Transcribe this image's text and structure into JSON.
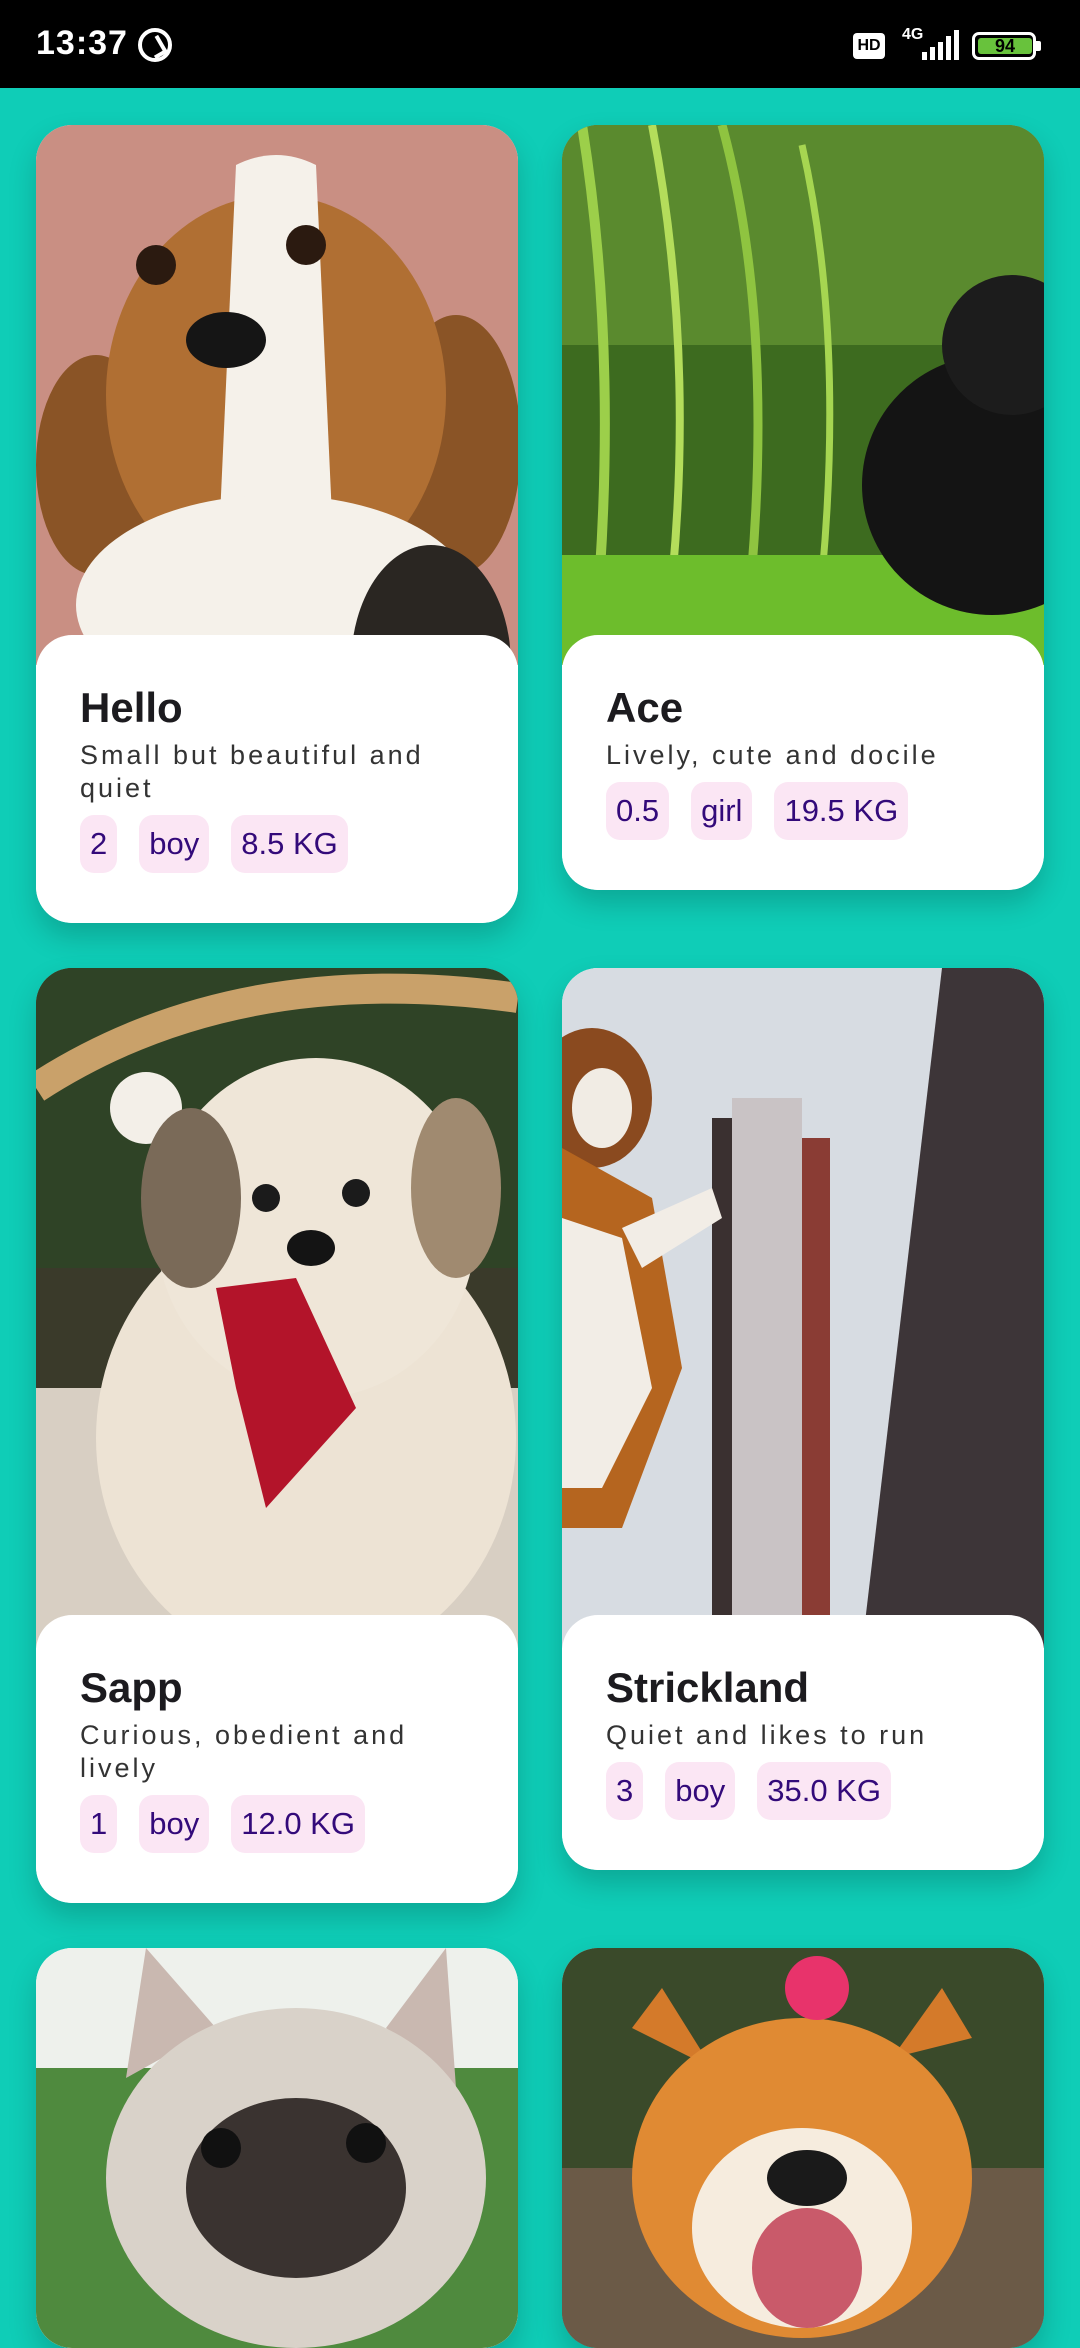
{
  "status_bar": {
    "time": "13:37",
    "network_type": "4G",
    "hd_label": "HD",
    "battery_level": "94"
  },
  "dogs": [
    {
      "name": "Hello",
      "description": "Small but beautiful and quiet",
      "age": "2",
      "gender": "boy",
      "weight": "8.5 KG",
      "photo": "beagle-photo"
    },
    {
      "name": "Ace",
      "description": "Lively, cute and docile",
      "age": "0.5",
      "gender": "girl",
      "weight": "19.5 KG",
      "photo": "black-puppy-in-grass-photo"
    },
    {
      "name": "Sapp",
      "description": "Curious, obedient and lively",
      "age": "1",
      "gender": "boy",
      "weight": "12.0 KG",
      "photo": "shih-tzu-with-gift-bag-photo"
    },
    {
      "name": "Strickland",
      "description": "Quiet and likes to run",
      "age": "3",
      "gender": "boy",
      "weight": "35.0 KG",
      "photo": "hound-at-snowy-fence-photo"
    },
    {
      "photo": "french-bulldog-photo"
    },
    {
      "photo": "shiba-inu-with-flower-photo"
    }
  ],
  "colors": {
    "background": "#0fcdb7",
    "tag_background": "#fbe6f4",
    "tag_text": "#330a7a"
  }
}
